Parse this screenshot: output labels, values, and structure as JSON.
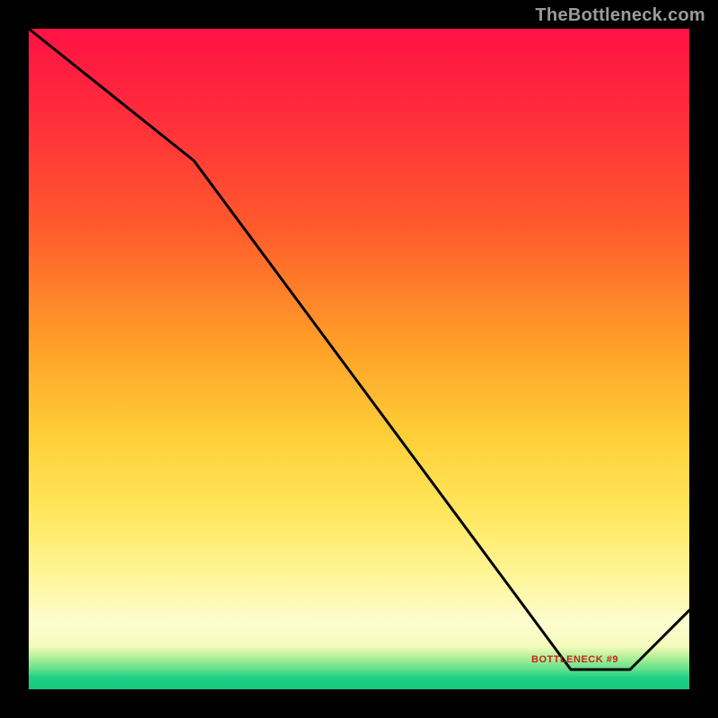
{
  "watermark": "TheBottleneck.com",
  "annotation_label": "BOTTLENECK #9",
  "colors": {
    "bg": "#000000",
    "curve": "#000000",
    "label": "#c8221d",
    "watermark": "#9b9b9b"
  },
  "chart_data": {
    "type": "line",
    "title": "",
    "xlabel": "",
    "ylabel": "",
    "xlim": [
      0,
      100
    ],
    "ylim": [
      0,
      100
    ],
    "series": [
      {
        "name": "curve",
        "x": [
          0,
          25,
          82,
          91,
          100
        ],
        "values": [
          100,
          80,
          3,
          3,
          12
        ]
      }
    ],
    "annotations": [
      {
        "text": "BOTTLENECK #9",
        "x": 83,
        "y": 5
      }
    ],
    "gradient_stops": [
      {
        "pct": 0,
        "color": "#ff1244"
      },
      {
        "pct": 48,
        "color": "#ffa028"
      },
      {
        "pct": 74,
        "color": "#ffe860"
      },
      {
        "pct": 90,
        "color": "#fdfccf"
      },
      {
        "pct": 100,
        "color": "#17c87f"
      }
    ]
  }
}
